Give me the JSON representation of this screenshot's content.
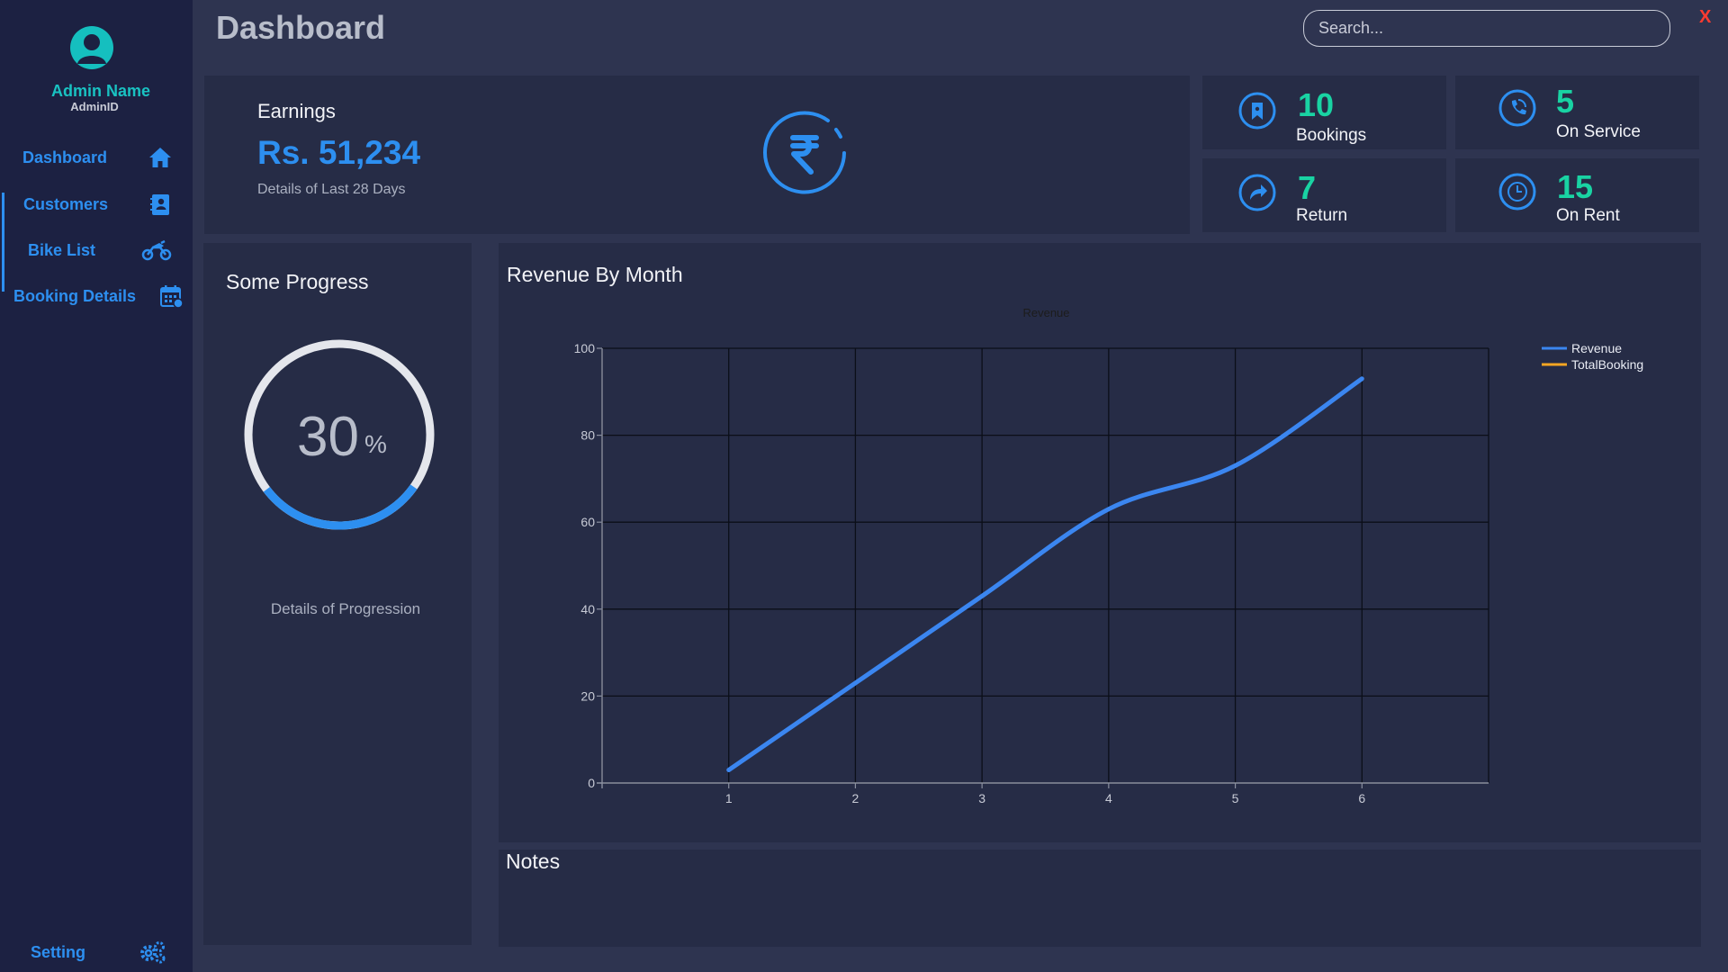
{
  "user": {
    "name": "Admin Name",
    "id": "AdminID"
  },
  "nav": [
    {
      "label": "Dashboard",
      "icon": "home-icon"
    },
    {
      "label": "Customers",
      "icon": "address-book-icon"
    },
    {
      "label": "Bike List",
      "icon": "motorcycle-icon"
    },
    {
      "label": "Booking Details",
      "icon": "calendar-icon"
    }
  ],
  "setting": {
    "label": "Setting",
    "icon": "gears-icon"
  },
  "header": {
    "title": "Dashboard",
    "search_placeholder": "Search...",
    "close_label": "X"
  },
  "earnings": {
    "title": "Earnings",
    "amount": "Rs. 51,234",
    "detail": "Details of Last 28 Days",
    "icon": "rupee-icon"
  },
  "stats": [
    {
      "value": "10",
      "label": "Bookings",
      "icon": "bookmark-icon"
    },
    {
      "value": "5",
      "label": "On Service",
      "icon": "phone-icon"
    },
    {
      "value": "7",
      "label": "Return",
      "icon": "share-arrow-icon"
    },
    {
      "value": "15",
      "label": "On Rent",
      "icon": "clock-icon"
    }
  ],
  "progress": {
    "title": "Some Progress",
    "value": "30",
    "unit": "%",
    "percent": 30,
    "detail": "Details of Progression"
  },
  "revenue_chart": {
    "panel_title": "Revenue By Month"
  },
  "notes": {
    "title": "Notes"
  },
  "colors": {
    "accent": "#2d8ff0",
    "teal": "#19d3a3",
    "sidebar_bg": "#1c2142",
    "panel_bg": "#262c46",
    "page_bg": "#2e3450",
    "close": "#ff3b30",
    "series_revenue": "#3b86f0",
    "series_totalbooking": "#f5a623"
  },
  "chart_data": {
    "type": "line",
    "title": "Revenue",
    "xlabel": "",
    "ylabel": "",
    "x": [
      1,
      2,
      3,
      4,
      5,
      6
    ],
    "xlim": [
      0,
      7
    ],
    "ylim": [
      0,
      100
    ],
    "xticks": [
      "1",
      "2",
      "3",
      "4",
      "5",
      "6"
    ],
    "yticks": [
      "0",
      "20",
      "40",
      "60",
      "80",
      "100"
    ],
    "grid": true,
    "legend": "top-right",
    "series": [
      {
        "name": "Revenue",
        "values": [
          3,
          23,
          43,
          63,
          73,
          93
        ]
      },
      {
        "name": "TotalBooking",
        "values": []
      }
    ]
  }
}
